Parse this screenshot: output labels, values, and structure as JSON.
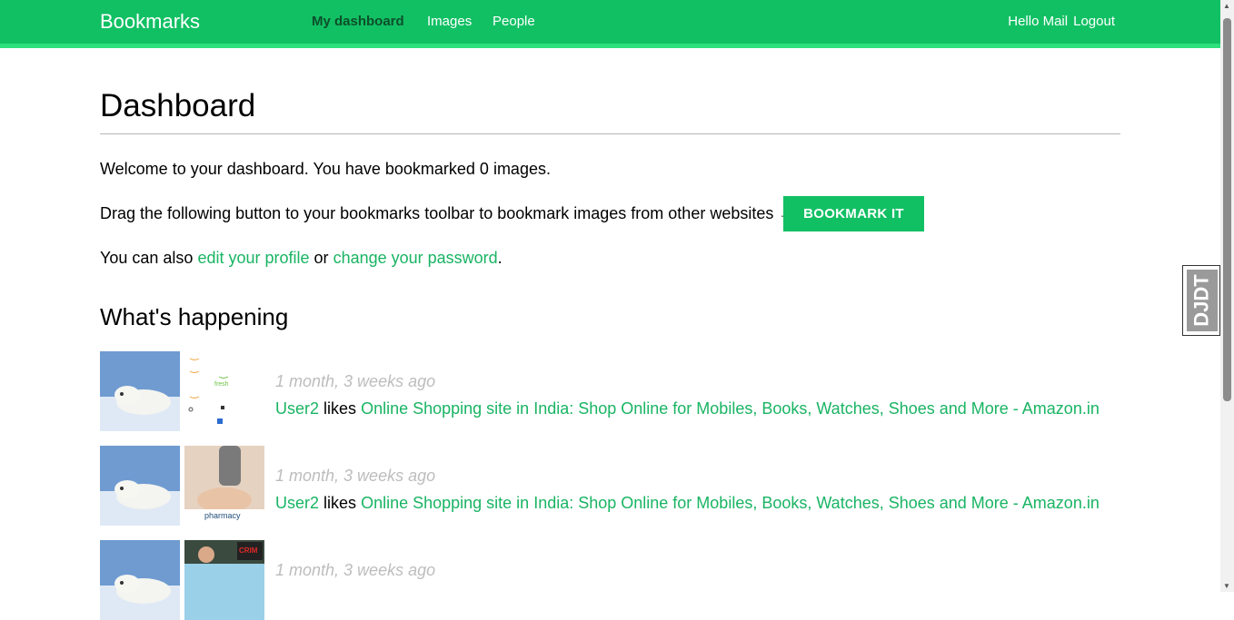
{
  "nav": {
    "brand": "Bookmarks",
    "links": [
      "My dashboard",
      "Images",
      "People"
    ],
    "greeting": "Hello Mail",
    "logout": "Logout"
  },
  "page": {
    "title": "Dashboard",
    "welcome": "Welcome to your dashboard. You have bookmarked 0 images.",
    "drag_text": "Drag the following button to your bookmarks toolbar to bookmark images from other websites →",
    "bookmark_button": "BOOKMARK IT",
    "also_prefix": "You can also",
    "edit_profile_link": "edit your profile",
    "or_text": "or",
    "change_password_link": "change your password",
    "period": "."
  },
  "activity": {
    "heading": "What's happening",
    "items": [
      {
        "date": "1 month, 3 weeks ago",
        "user": "User2",
        "verb": "likes",
        "target": "Online Shopping site in India: Shop Online for Mobiles, Books, Watches, Shoes and More - Amazon.in",
        "thumb_text": "fresh"
      },
      {
        "date": "1 month, 3 weeks ago",
        "user": "User2",
        "verb": "likes",
        "target": "Online Shopping site in India: Shop Online for Mobiles, Books, Watches, Shoes and More - Amazon.in",
        "thumb_text": "pharmacy"
      },
      {
        "date": "1 month, 3 weeks ago",
        "user": "",
        "verb": "",
        "target": "",
        "thumb_text": "CRIM"
      }
    ]
  },
  "toolbar": {
    "label": "DJDT"
  },
  "colors": {
    "brand_green": "#12c064",
    "link_green": "#19b463"
  }
}
